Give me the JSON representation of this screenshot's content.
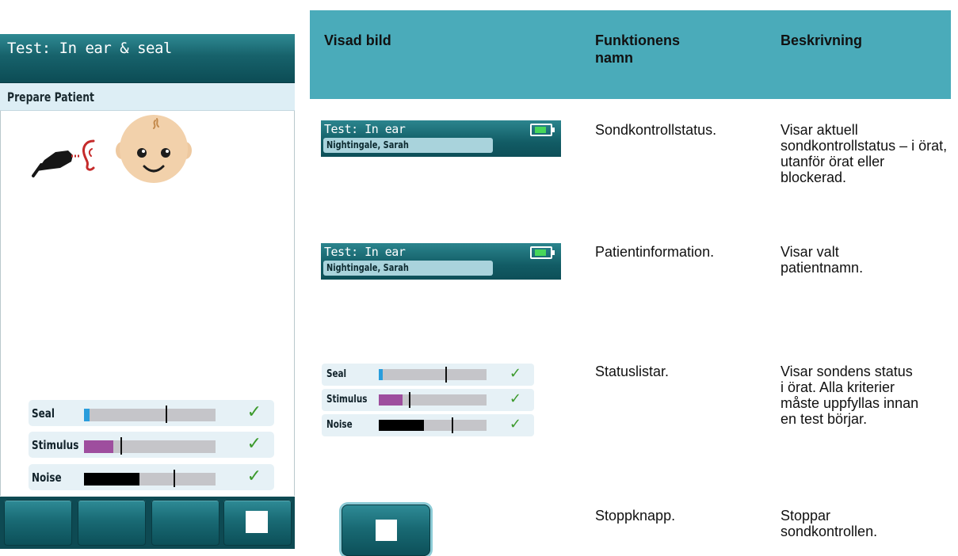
{
  "device": {
    "title": "Test: In ear & seal",
    "subtitle": "Prepare Patient",
    "status_rows": [
      {
        "label": "Seal",
        "fill_color": "#2a9ddc",
        "fill_fraction": 0.04,
        "marker_fraction": 0.62,
        "ok": true
      },
      {
        "label": "Stimulus",
        "fill_color": "#9e4e9e",
        "fill_fraction": 0.22,
        "marker_fraction": 0.28,
        "ok": true
      },
      {
        "label": "Noise",
        "fill_color": "#000000",
        "fill_fraction": 0.42,
        "marker_fraction": 0.68,
        "ok": true
      }
    ],
    "buttons": [
      "",
      "",
      "",
      "stop"
    ],
    "icons": [
      "probe-icon",
      "ear-icon",
      "baby-face-icon",
      "checkmark-icon",
      "stop-icon"
    ]
  },
  "table": {
    "headers": {
      "image": "Visad bild",
      "function_name": "Funktionens namn",
      "description": "Beskrivning"
    },
    "rows": [
      {
        "mini_title": "Test: In ear",
        "mini_patient": "Nightingale, Sarah",
        "name": "Sondkontrollstatus.",
        "description": "Visar aktuell sondkontrollstatus – i örat, utanför örat eller blockerad."
      },
      {
        "mini_title": "Test: In ear",
        "mini_patient": "Nightingale, Sarah",
        "name": "Patientinformation.",
        "description": "Visar valt patientnamn."
      },
      {
        "name": "Statuslistar.",
        "description": "Visar sondens status i örat.  Alla kriterier måste uppfyllas innan en test börjar.",
        "status_rows": [
          {
            "label": "Seal",
            "fill_color": "#2a9ddc",
            "fill_fraction": 0.04,
            "marker_fraction": 0.62,
            "ok": true
          },
          {
            "label": "Stimulus",
            "fill_color": "#9e4e9e",
            "fill_fraction": 0.22,
            "marker_fraction": 0.28,
            "ok": true
          },
          {
            "label": "Noise",
            "fill_color": "#000000",
            "fill_fraction": 0.42,
            "marker_fraction": 0.68,
            "ok": true
          }
        ]
      },
      {
        "name": "Stoppknapp.",
        "description": "Stoppar sondkontrollen."
      }
    ]
  },
  "colors": {
    "header_teal": "#4aabba",
    "device_dark_teal": "#0e4a53",
    "check_green": "#3c9a2c",
    "battery_green": "#47d65a"
  }
}
